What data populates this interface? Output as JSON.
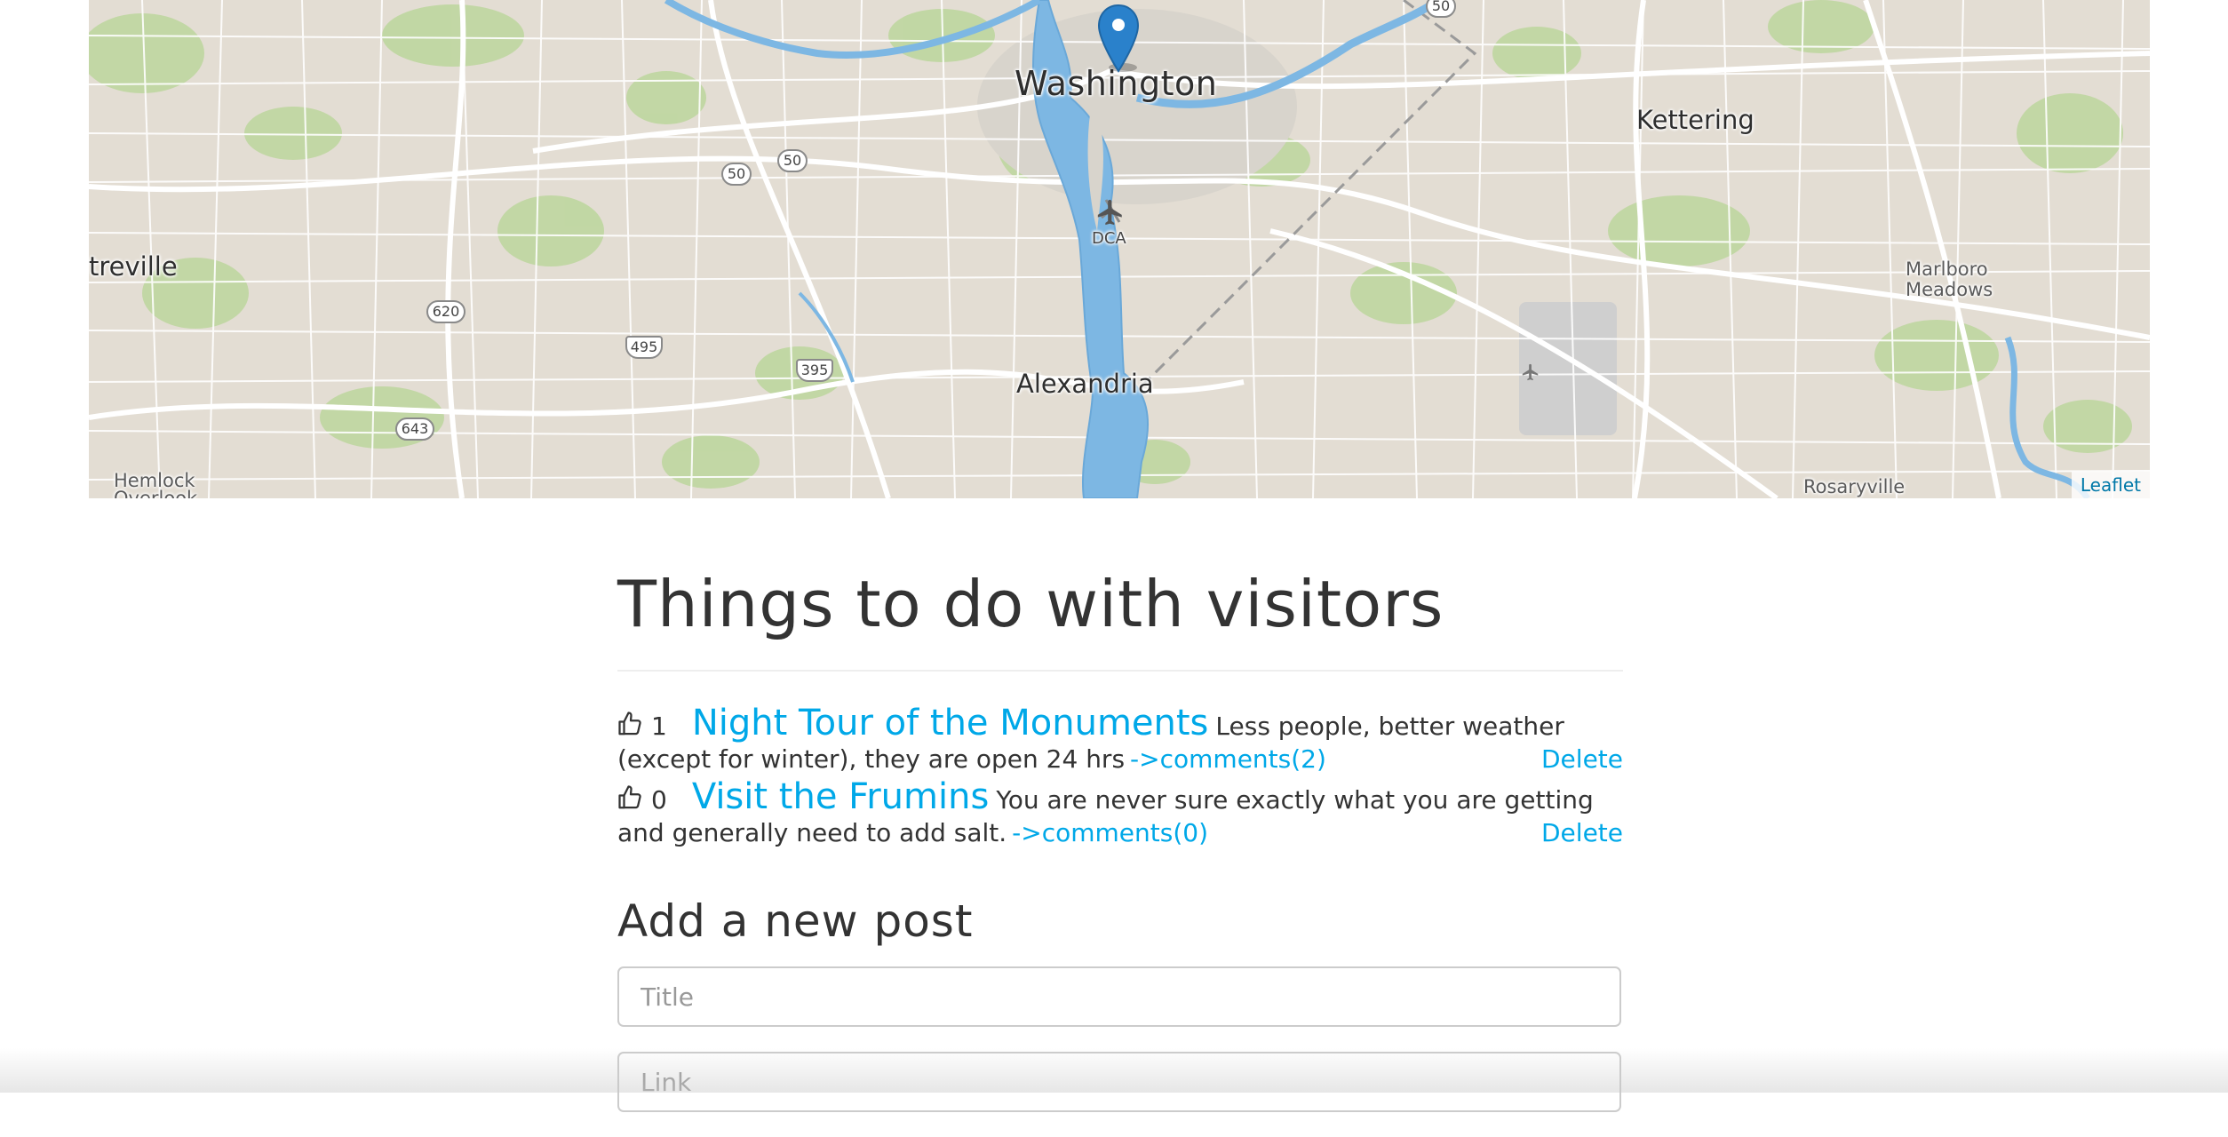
{
  "map": {
    "labels": {
      "washington": "Washington",
      "kettering": "Kettering",
      "treville": "treville",
      "marlboro": "Marlboro",
      "meadows": "Meadows",
      "alexandria": "Alexandria",
      "dca": "DCA",
      "hemlock": "Hemlock",
      "overlook": "Overlook",
      "rosaryville": "Rosaryville"
    },
    "shields": {
      "s50a": "50",
      "s50b": "50",
      "s50c": "50",
      "s620": "620",
      "s495": "495",
      "s395": "395",
      "s643": "643"
    },
    "attribution": "Leaflet",
    "marker_icon": "map-marker-icon"
  },
  "page": {
    "title": "Things to do with visitors"
  },
  "posts": [
    {
      "votes": "1",
      "title": "Night Tour of the Monuments",
      "description": "Less people, better weather (except for winter), they are open 24 hrs",
      "comments_link": "->comments(2)",
      "delete_label": "Delete"
    },
    {
      "votes": "0",
      "title": "Visit the Frumins",
      "description": "You are never sure exactly what you are getting and generally need to add salt.",
      "comments_link": "->comments(0)",
      "delete_label": "Delete"
    }
  ],
  "new_post": {
    "heading": "Add a new post",
    "title_placeholder": "Title",
    "link_placeholder": "Link"
  },
  "icons": {
    "thumbs_up": "thumbs-up-icon"
  },
  "colors": {
    "link": "#00a8e8",
    "text": "#333333",
    "water": "#7db7e3",
    "land": "#e3ddd3",
    "park": "#b9d49a"
  }
}
